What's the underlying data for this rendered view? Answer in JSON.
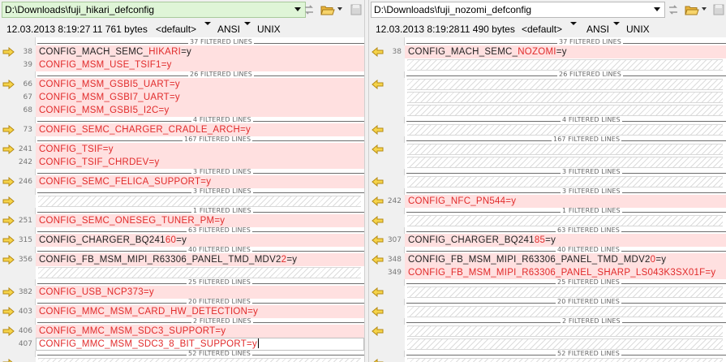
{
  "left": {
    "path": "D:\\Downloads\\fuji_hikari_defconfig",
    "date": "12.03.2013 8:19:27",
    "size": "11 761 bytes",
    "profile": "<default>",
    "encoding": "ANSI",
    "line_endings": "UNIX"
  },
  "right": {
    "path": "D:\\Downloads\\fuji_nozomi_defconfig",
    "date": "12.03.2013 8:19:28",
    "size": "11 490 bytes",
    "profile": "<default>",
    "encoding": "ANSI",
    "line_endings": "UNIX"
  },
  "separators": [
    "37 FILTERED LINES",
    "26 FILTERED LINES",
    "4 FILTERED LINES",
    "167 FILTERED LINES",
    "3 FILTERED LINES",
    "3 FILTERED LINES",
    "1 FILTERED LINES",
    "63 FILTERED LINES",
    "40 FILTERED LINES",
    "25 FILTERED LINES",
    "20 FILTERED LINES",
    "2 FILTERED LINES",
    "52 FILTERED LINES"
  ],
  "left_lines": [
    {
      "num": "38",
      "same": "CONFIG_MACH_SEMC_",
      "diff": "HIKARI",
      "tail": "=y"
    },
    {
      "num": "39",
      "same": "",
      "diff": "CONFIG_MSM_USE_TSIF1=y",
      "tail": ""
    },
    {
      "num": "66",
      "same": "",
      "diff": "CONFIG_MSM_GSBI5_UART=y",
      "tail": ""
    },
    {
      "num": "67",
      "same": "",
      "diff": "CONFIG_MSM_GSBI7_UART=y",
      "tail": ""
    },
    {
      "num": "68",
      "same": "",
      "diff": "CONFIG_MSM_GSBI5_I2C=y",
      "tail": ""
    },
    {
      "num": "73",
      "same": "",
      "diff": "CONFIG_SEMC_CHARGER_CRADLE_ARCH=y",
      "tail": ""
    },
    {
      "num": "241",
      "same": "",
      "diff": "CONFIG_TSIF=y",
      "tail": ""
    },
    {
      "num": "242",
      "same": "",
      "diff": "CONFIG_TSIF_CHRDEV=y",
      "tail": ""
    },
    {
      "num": "246",
      "same": "",
      "diff": "CONFIG_SEMC_FELICA_SUPPORT=y",
      "tail": ""
    },
    {
      "num": "251",
      "same": "",
      "diff": "CONFIG_SEMC_ONESEG_TUNER_PM=y",
      "tail": ""
    },
    {
      "num": "315",
      "same": "CONFIG_CHARGER_BQ241",
      "diff": "60",
      "tail": "=y"
    },
    {
      "num": "356",
      "same": "CONFIG_FB_MSM_MIPI_R63306_PANEL_TMD_MDV2",
      "diff": "2",
      "tail": "=y"
    },
    {
      "num": "382",
      "same": "",
      "diff": "CONFIG_USB_NCP373=y",
      "tail": ""
    },
    {
      "num": "403",
      "same": "",
      "diff": "CONFIG_MMC_MSM_CARD_HW_DETECTION=y",
      "tail": ""
    },
    {
      "num": "406",
      "same": "",
      "diff": "CONFIG_MMC_MSM_SDC3_SUPPORT=y",
      "tail": ""
    },
    {
      "num": "407",
      "same": "",
      "diff": "CONFIG_MMC_MSM_SDC3_8_BIT_SUPPORT=y",
      "tail": ""
    }
  ],
  "right_lines": [
    {
      "num": "38",
      "same": "CONFIG_MACH_SEMC_",
      "diff": "NOZOMI",
      "tail": "=y"
    },
    {
      "num": "242",
      "same": "",
      "diff": "CONFIG_NFC_PN544=y",
      "tail": ""
    },
    {
      "num": "307",
      "same": "CONFIG_CHARGER_BQ241",
      "diff": "85",
      "tail": "=y"
    },
    {
      "num": "348",
      "same": "CONFIG_FB_MSM_MIPI_R63306_PANEL_TMD_MDV2",
      "diff": "0",
      "tail": "=y"
    },
    {
      "num": "349",
      "same": "",
      "diff": "CONFIG_FB_MSM_MIPI_R63306_PANEL_SHARP_LS043K3SX01F=y",
      "tail": ""
    }
  ]
}
